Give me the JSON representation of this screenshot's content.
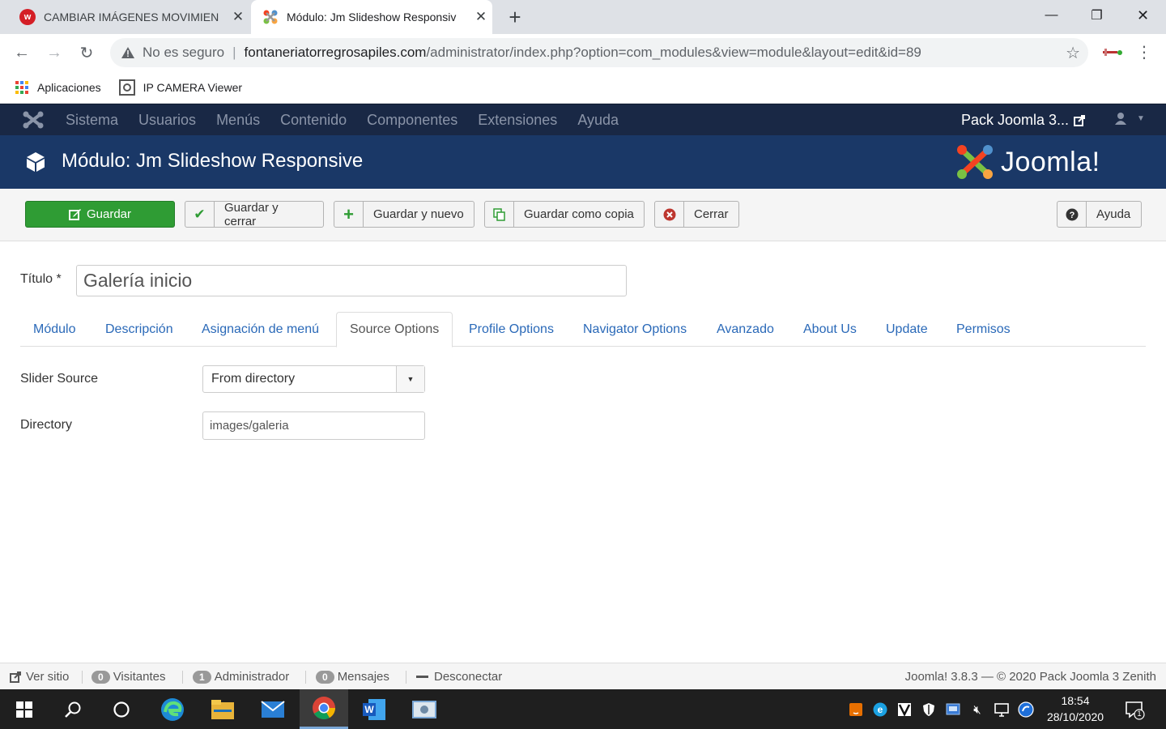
{
  "browser": {
    "tabs": [
      {
        "title": "CAMBIAR IMÁGENES MOVIMIEN",
        "active": false
      },
      {
        "title": "Módulo: Jm Slideshow Responsiv",
        "active": true
      }
    ],
    "security_label": "No es seguro",
    "url_host": "fontaneriatorregrosapiles.com",
    "url_path": "/administrator/index.php?option=com_modules&view=module&layout=edit&id=89",
    "bookmarks": [
      "Aplicaciones",
      "IP CAMERA Viewer"
    ]
  },
  "joomla_nav": {
    "menu": [
      "Sistema",
      "Usuarios",
      "Menús",
      "Contenido",
      "Componentes",
      "Extensiones",
      "Ayuda"
    ],
    "site_link": "Pack Joomla 3..."
  },
  "header": {
    "title": "Módulo: Jm Slideshow Responsive",
    "brand": "Joomla!"
  },
  "toolbar": {
    "save": "Guardar",
    "save_close": "Guardar y cerrar",
    "save_new": "Guardar y nuevo",
    "save_copy": "Guardar como copia",
    "close": "Cerrar",
    "help": "Ayuda"
  },
  "form": {
    "title_label": "Título *",
    "title_value": "Galería inicio",
    "tabs": [
      "Módulo",
      "Descripción",
      "Asignación de menú",
      "Source Options",
      "Profile Options",
      "Navigator Options",
      "Avanzado",
      "About Us",
      "Update",
      "Permisos"
    ],
    "active_tab": "Source Options",
    "slider_source_label": "Slider Source",
    "slider_source_value": "From directory",
    "directory_label": "Directory",
    "directory_value": "images/galeria"
  },
  "statusbar": {
    "view_site": "Ver sitio",
    "visitors_count": "0",
    "visitors_label": "Visitantes",
    "admin_count": "1",
    "admin_label": "Administrador",
    "messages_count": "0",
    "messages_label": "Mensajes",
    "logout": "Desconectar",
    "version": "Joomla! 3.8.3 — © 2020 Pack Joomla 3 Zenith"
  },
  "taskbar": {
    "time": "18:54",
    "date": "28/10/2020",
    "notification_count": "1"
  },
  "colors": {
    "nav_bg": "#192845",
    "header_bg": "#1a3867",
    "save_green": "#2f9c34",
    "link_blue": "#2a69b8"
  }
}
